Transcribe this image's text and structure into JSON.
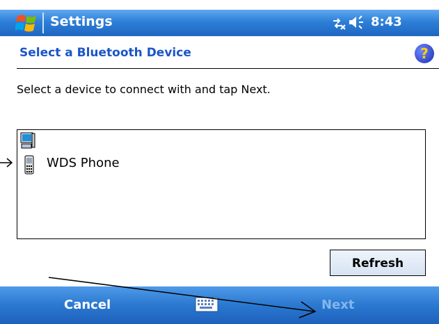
{
  "titlebar": {
    "app_title": "Settings",
    "time": "8:43",
    "start_icon": "windows-flag-icon",
    "connectivity_icon": "connectivity-icon",
    "volume_icon": "speaker-icon"
  },
  "page": {
    "heading": "Select a Bluetooth Device",
    "help_glyph": "?",
    "instruction": "Select a device to connect with and tap Next."
  },
  "devices": [
    {
      "label": "",
      "icon": "computer-icon"
    },
    {
      "label": "WDS Phone",
      "icon": "phone-icon"
    }
  ],
  "buttons": {
    "refresh": "Refresh"
  },
  "menubar": {
    "left_softkey": "Cancel",
    "right_softkey": "Next",
    "sip_icon": "keyboard-icon"
  },
  "colors": {
    "bar_blue": "#2d7fd8",
    "heading_blue": "#1b55c7",
    "disabled_text": "#84b6ec"
  }
}
